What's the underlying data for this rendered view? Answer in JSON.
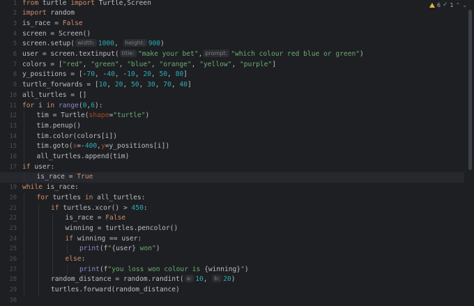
{
  "editor": {
    "current_line": 18,
    "inspections": {
      "warnings": "6",
      "ok": "1"
    },
    "lines": [
      {
        "n": "1",
        "indent": 0,
        "tokens": [
          {
            "t": "from",
            "c": "kw"
          },
          {
            "t": " turtle "
          },
          {
            "t": "import",
            "c": "kw"
          },
          {
            "t": " Turtle,Screen"
          }
        ]
      },
      {
        "n": "2",
        "indent": 0,
        "tokens": [
          {
            "t": "import",
            "c": "kw"
          },
          {
            "t": " random"
          }
        ]
      },
      {
        "n": "3",
        "indent": 0,
        "tokens": [
          {
            "t": "is_race = "
          },
          {
            "t": "False",
            "c": "kw"
          }
        ]
      },
      {
        "n": "4",
        "indent": 0,
        "tokens": [
          {
            "t": "screen = Screen()"
          }
        ]
      },
      {
        "n": "5",
        "indent": 0,
        "tokens": [
          {
            "t": "screen.setup("
          },
          {
            "h": "width:"
          },
          {
            "t": "1000",
            "c": "num"
          },
          {
            "t": ", "
          },
          {
            "h": "height:"
          },
          {
            "t": "900",
            "c": "num"
          },
          {
            "t": ")"
          }
        ]
      },
      {
        "n": "6",
        "indent": 0,
        "tokens": [
          {
            "t": "user = screen.textinput("
          },
          {
            "h": "title:"
          },
          {
            "t": "\"make your bet\"",
            "c": "str"
          },
          {
            "t": ","
          },
          {
            "h": "prompt:"
          },
          {
            "t": "\"which colour red blue or green\"",
            "c": "str"
          },
          {
            "t": ")"
          }
        ]
      },
      {
        "n": "7",
        "indent": 0,
        "tokens": [
          {
            "t": "colors = ["
          },
          {
            "t": "\"red\"",
            "c": "str"
          },
          {
            "t": ", "
          },
          {
            "t": "\"green\"",
            "c": "str"
          },
          {
            "t": ", "
          },
          {
            "t": "\"blue\"",
            "c": "str"
          },
          {
            "t": ", "
          },
          {
            "t": "\"orange\"",
            "c": "str"
          },
          {
            "t": ", "
          },
          {
            "t": "\"yellow\"",
            "c": "str"
          },
          {
            "t": ", "
          },
          {
            "t": "\"purple\"",
            "c": "str"
          },
          {
            "t": "]"
          }
        ]
      },
      {
        "n": "8",
        "indent": 0,
        "tokens": [
          {
            "t": "y_positions = [-"
          },
          {
            "t": "70",
            "c": "num"
          },
          {
            "t": ", -"
          },
          {
            "t": "40",
            "c": "num"
          },
          {
            "t": ", -"
          },
          {
            "t": "10",
            "c": "num"
          },
          {
            "t": ", "
          },
          {
            "t": "20",
            "c": "num"
          },
          {
            "t": ", "
          },
          {
            "t": "50",
            "c": "num"
          },
          {
            "t": ", "
          },
          {
            "t": "80",
            "c": "num"
          },
          {
            "t": "]"
          }
        ]
      },
      {
        "n": "9",
        "indent": 0,
        "tokens": [
          {
            "t": "turtle_forwards = ["
          },
          {
            "t": "10",
            "c": "num"
          },
          {
            "t": ", "
          },
          {
            "t": "20",
            "c": "num"
          },
          {
            "t": ", "
          },
          {
            "t": "50",
            "c": "num"
          },
          {
            "t": ", "
          },
          {
            "t": "30",
            "c": "num"
          },
          {
            "t": ", "
          },
          {
            "t": "70",
            "c": "num"
          },
          {
            "t": ", "
          },
          {
            "t": "40",
            "c": "num"
          },
          {
            "t": "]"
          }
        ]
      },
      {
        "n": "10",
        "indent": 0,
        "tokens": [
          {
            "t": "all_turtles = []"
          }
        ]
      },
      {
        "n": "11",
        "indent": 0,
        "tokens": [
          {
            "t": "for",
            "c": "kw"
          },
          {
            "t": " i "
          },
          {
            "t": "in",
            "c": "kw"
          },
          {
            "t": " "
          },
          {
            "t": "range",
            "c": "bi"
          },
          {
            "t": "("
          },
          {
            "t": "0",
            "c": "num"
          },
          {
            "t": ","
          },
          {
            "t": "6",
            "c": "num"
          },
          {
            "t": "):"
          }
        ]
      },
      {
        "n": "12",
        "indent": 1,
        "tokens": [
          {
            "t": "tim = Turtle("
          },
          {
            "t": "shape",
            "c": "param"
          },
          {
            "t": "="
          },
          {
            "t": "\"turtle\"",
            "c": "str"
          },
          {
            "t": ")"
          }
        ]
      },
      {
        "n": "13",
        "indent": 1,
        "tokens": [
          {
            "t": "tim.penup()"
          }
        ]
      },
      {
        "n": "14",
        "indent": 1,
        "tokens": [
          {
            "t": "tim.color(colors[i])"
          }
        ]
      },
      {
        "n": "15",
        "indent": 1,
        "tokens": [
          {
            "t": "tim.goto("
          },
          {
            "t": "x",
            "c": "param"
          },
          {
            "t": "=-"
          },
          {
            "t": "400",
            "c": "num"
          },
          {
            "t": ","
          },
          {
            "t": "y",
            "c": "param"
          },
          {
            "t": "=y_positions[i])"
          }
        ]
      },
      {
        "n": "16",
        "indent": 1,
        "tokens": [
          {
            "t": "all_turtles.append(tim)"
          }
        ]
      },
      {
        "n": "17",
        "indent": 0,
        "tokens": [
          {
            "t": "if",
            "c": "kw"
          },
          {
            "t": " user:"
          }
        ]
      },
      {
        "n": "18",
        "indent": 1,
        "tokens": [
          {
            "t": "is_race = "
          },
          {
            "t": "True",
            "c": "kw"
          }
        ]
      },
      {
        "n": "19",
        "indent": 0,
        "tokens": [
          {
            "t": "while",
            "c": "kw"
          },
          {
            "t": " is_race:"
          }
        ]
      },
      {
        "n": "20",
        "indent": 1,
        "tokens": [
          {
            "t": "for",
            "c": "kw"
          },
          {
            "t": " turtles "
          },
          {
            "t": "in",
            "c": "kw"
          },
          {
            "t": " all_turtles:"
          }
        ]
      },
      {
        "n": "21",
        "indent": 2,
        "tokens": [
          {
            "t": "if",
            "c": "kw"
          },
          {
            "t": " turtles.xcor() > "
          },
          {
            "t": "450",
            "c": "num"
          },
          {
            "t": ":"
          }
        ]
      },
      {
        "n": "22",
        "indent": 3,
        "tokens": [
          {
            "t": "is_race = "
          },
          {
            "t": "False",
            "c": "kw"
          }
        ]
      },
      {
        "n": "23",
        "indent": 3,
        "tokens": [
          {
            "t": "winning = turtles.pencolor()"
          }
        ]
      },
      {
        "n": "24",
        "indent": 3,
        "tokens": [
          {
            "t": "if",
            "c": "kw"
          },
          {
            "t": " winning == user:"
          }
        ]
      },
      {
        "n": "25",
        "indent": 4,
        "tokens": [
          {
            "t": "print",
            "c": "bi"
          },
          {
            "t": "(f"
          },
          {
            "t": "\"",
            "c": "str"
          },
          {
            "t": "{user}"
          },
          {
            "t": " won\"",
            "c": "str"
          },
          {
            "t": ")"
          }
        ]
      },
      {
        "n": "26",
        "indent": 3,
        "tokens": [
          {
            "t": "else",
            "c": "kw"
          },
          {
            "t": ":"
          }
        ]
      },
      {
        "n": "27",
        "indent": 4,
        "tokens": [
          {
            "t": "print",
            "c": "bi"
          },
          {
            "t": "(f"
          },
          {
            "t": "\"you loss won colour is ",
            "c": "str"
          },
          {
            "t": "{winning}"
          },
          {
            "t": "\"",
            "c": "str"
          },
          {
            "t": ")"
          }
        ]
      },
      {
        "n": "28",
        "indent": 2,
        "tokens": [
          {
            "t": "random_distance = random.randint("
          },
          {
            "h": "a:"
          },
          {
            "t": "10",
            "c": "num"
          },
          {
            "t": ", "
          },
          {
            "h": "b:"
          },
          {
            "t": "20",
            "c": "num"
          },
          {
            "t": ")"
          }
        ]
      },
      {
        "n": "29",
        "indent": 2,
        "tokens": [
          {
            "t": "turtles.forward(random_distance)"
          }
        ]
      },
      {
        "n": "30",
        "indent": 0,
        "tokens": []
      }
    ]
  }
}
